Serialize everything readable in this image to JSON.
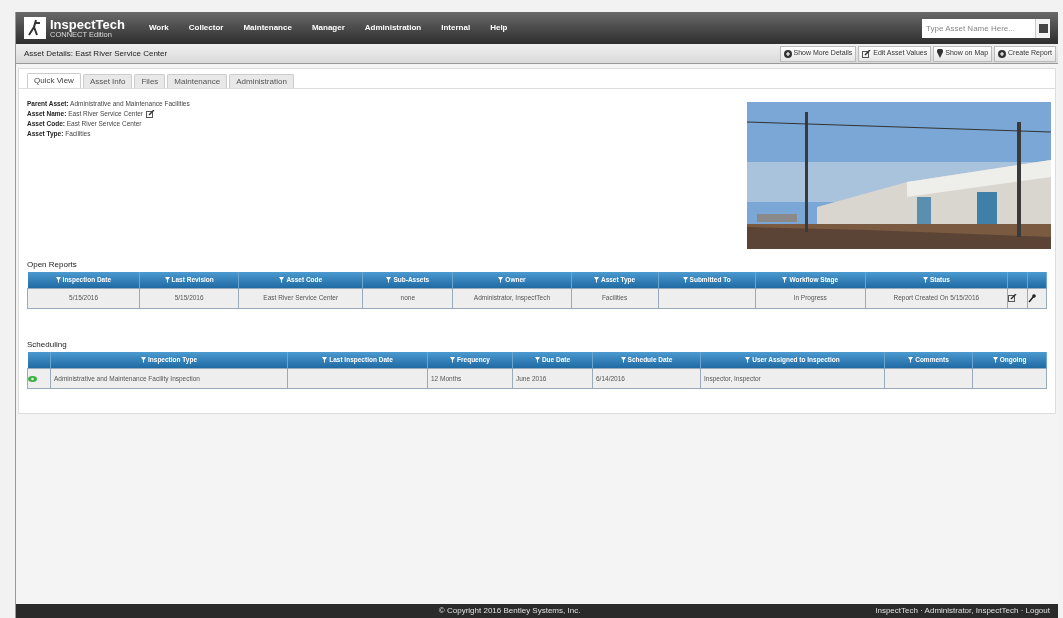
{
  "brand": {
    "name": "InspectTech",
    "subtitle": "CONNECT Edition"
  },
  "menu": [
    "Work",
    "Collector",
    "Maintenance",
    "Manager",
    "Administration",
    "Internal",
    "Help"
  ],
  "search": {
    "placeholder": "Type Asset Name Here..."
  },
  "page_title": "Asset Details: East River Service Center",
  "actions": [
    {
      "label": "Show More Details",
      "kind": "add"
    },
    {
      "label": "Edit Asset Values",
      "kind": "edit"
    },
    {
      "label": "Show on Map",
      "kind": "map"
    },
    {
      "label": "Create Report",
      "kind": "add"
    }
  ],
  "tabs": [
    {
      "label": "Quick View",
      "selected": true
    },
    {
      "label": "Asset Info",
      "selected": false
    },
    {
      "label": "Files",
      "selected": false
    },
    {
      "label": "Maintenance",
      "selected": false
    },
    {
      "label": "Administration",
      "selected": false
    }
  ],
  "details": [
    {
      "label": "Parent Asset:",
      "value": "Administrative and Maintenance Facilities"
    },
    {
      "label": "Asset Name:",
      "value": "East River Service Center",
      "editable": true
    },
    {
      "label": "Asset Code:",
      "value": "East River Service Center"
    },
    {
      "label": "Asset Type:",
      "value": "Facilities"
    }
  ],
  "open_reports": {
    "title": "Open Reports",
    "columns": [
      "Inspection Date",
      "Last Revision",
      "Asset Code",
      "Sub-Assets",
      "Owner",
      "Asset Type",
      "Submitted To",
      "Workflow Stage",
      "Status"
    ],
    "rows": [
      {
        "cells": [
          "5/15/2016",
          "5/15/2016",
          "East River Service Center",
          "none",
          "Administrator, InspectTech",
          "Facilities",
          null,
          "In Progress",
          "Report Created On 5/15/2016"
        ]
      }
    ]
  },
  "scheduling": {
    "title": "Scheduling",
    "columns": [
      "Inspection Type",
      "Last Inspection Date",
      "Frequency",
      "Due Date",
      "Schedule Date",
      "User Assigned to Inspection",
      "Comments",
      "Ongoing"
    ],
    "rows": [
      {
        "cells": [
          "Administrative and Maintenance Facility Inspection",
          null,
          "12 Months",
          "June 2016",
          "6/14/2016",
          "Inspector, Inspector",
          null,
          null
        ]
      }
    ]
  },
  "footer": {
    "copyright": "© Copyright 2016 Bentley Systems, Inc.",
    "user": "InspectTech · Administrator, InspectTech · Logout"
  }
}
